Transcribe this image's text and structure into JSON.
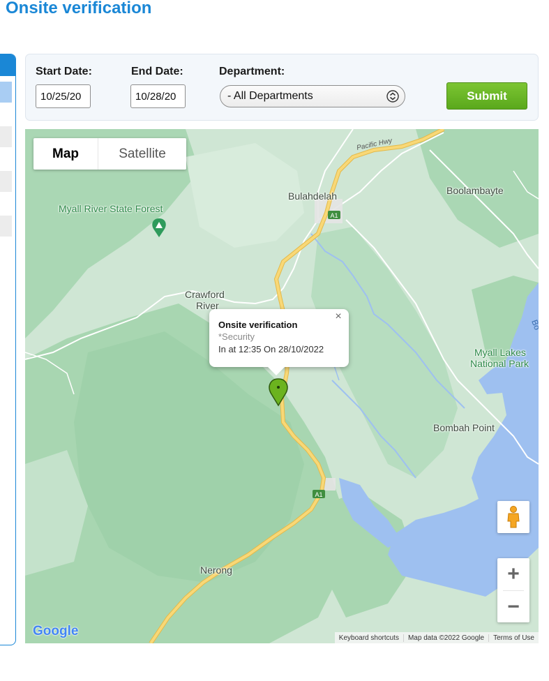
{
  "page": {
    "title": "Onsite verification"
  },
  "filters": {
    "start_date_label": "Start Date:",
    "start_date_value": "10/25/20",
    "end_date_label": "End Date:",
    "end_date_value": "10/28/20",
    "department_label": "Department:",
    "department_selected": "- All Departments",
    "submit_label": "Submit"
  },
  "map": {
    "type_controls": {
      "map_label": "Map",
      "satellite_label": "Satellite",
      "active": "Map"
    },
    "labels": {
      "bulahdelah": "Bulahdelah",
      "boolambayte": "Boolambayte",
      "myall_river_state_forest": "Myall River State Forest",
      "crawford": "Crawford",
      "river": "River",
      "myall_lakes": "Myall Lakes",
      "national_park": "National Park",
      "bombah_point": "Bombah Point",
      "nerong": "Nerong",
      "pacific_hwy": "Pacific Hwy",
      "a1": "A1",
      "bo": "Bo"
    },
    "info_window": {
      "title": "Onsite verification",
      "department": "*Security",
      "detail": "In at 12:35 On 28/10/2022",
      "close_glyph": "×"
    },
    "zoom": {
      "in_glyph": "+",
      "out_glyph": "−"
    },
    "attribution": {
      "keyboard": "Keyboard shortcuts",
      "data": "Map data ©2022 Google",
      "terms": "Terms of Use"
    },
    "logo_text": "Google",
    "colors": {
      "land": "#cfe6d4",
      "forest": "#a8d6b1",
      "water": "#9ec0f0",
      "highway": "#f6cf65",
      "marker": "#6bb31e"
    }
  }
}
